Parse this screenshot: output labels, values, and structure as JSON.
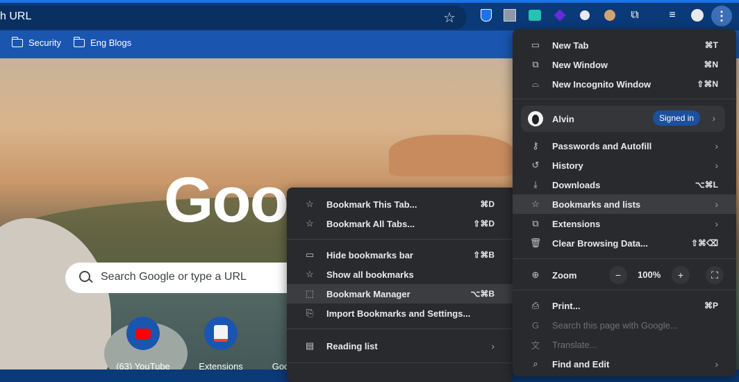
{
  "toolbar": {
    "omnibox_text": "h URL",
    "star_icon": "bookmark-star-icon",
    "extensions": [
      "shield-ext-icon",
      "square-ext-icon",
      "teal-ext-icon",
      "purple-ext-icon",
      "leaf-ext-icon",
      "owl-ext-icon",
      "puzzle-icon",
      "media-icon",
      "profile-avatar-icon"
    ],
    "menu_icon": "kebab-menu-icon"
  },
  "bookmarks_bar": {
    "items": [
      {
        "label": "Security"
      },
      {
        "label": "Eng Blogs"
      }
    ]
  },
  "new_tab": {
    "logo": "Goo",
    "search_placeholder": "Search Google or type a URL",
    "shortcuts": [
      {
        "label": "(63) YouTube"
      },
      {
        "label": "Extensions"
      },
      {
        "label": "Goo"
      }
    ]
  },
  "main_menu": {
    "items": [
      {
        "label": "New Tab",
        "shortcut": "⌘T",
        "icon": "new-tab-icon"
      },
      {
        "label": "New Window",
        "shortcut": "⌘N",
        "icon": "new-window-icon"
      },
      {
        "label": "New Incognito Window",
        "shortcut": "⇧⌘N",
        "icon": "incognito-icon"
      }
    ],
    "profile": {
      "name": "Alvin",
      "status": "Signed in"
    },
    "items2": [
      {
        "label": "Passwords and Autofill",
        "icon": "key-icon",
        "submenu": true
      },
      {
        "label": "History",
        "icon": "history-icon",
        "submenu": true
      },
      {
        "label": "Downloads",
        "icon": "download-icon",
        "shortcut": "⌥⌘L"
      },
      {
        "label": "Bookmarks and lists",
        "icon": "star-icon",
        "submenu": true,
        "highlighted": true
      },
      {
        "label": "Extensions",
        "icon": "puzzle-icon",
        "submenu": true
      },
      {
        "label": "Clear Browsing Data...",
        "icon": "trash-icon",
        "shortcut": "⇧⌘⌫"
      }
    ],
    "zoom": {
      "label": "Zoom",
      "minus": "−",
      "value": "100%",
      "plus": "+"
    },
    "items3": [
      {
        "label": "Print...",
        "icon": "print-icon",
        "shortcut": "⌘P"
      },
      {
        "label": "Search this page with Google...",
        "icon": "google-g-icon",
        "disabled": true
      },
      {
        "label": "Translate...",
        "icon": "translate-icon",
        "disabled": true
      },
      {
        "label": "Find and Edit",
        "icon": "find-icon",
        "submenu": true
      }
    ]
  },
  "bookmarks_submenu": {
    "items": [
      {
        "label": "Bookmark This Tab...",
        "shortcut": "⌘D",
        "icon": "star-outline-icon"
      },
      {
        "label": "Bookmark All Tabs...",
        "shortcut": "⇧⌘D",
        "icon": "star-outline-icon"
      }
    ],
    "items2": [
      {
        "label": "Hide bookmarks bar",
        "shortcut": "⇧⌘B",
        "icon": "bookmarks-bar-icon"
      },
      {
        "label": "Show all bookmarks",
        "icon": "star-outline-icon"
      },
      {
        "label": "Bookmark Manager",
        "shortcut": "⌥⌘B",
        "icon": "bookmark-manager-icon",
        "highlighted": true
      },
      {
        "label": "Import Bookmarks and Settings...",
        "icon": "import-icon"
      }
    ],
    "items3": [
      {
        "label": "Reading list",
        "icon": "reading-list-icon",
        "submenu": true
      }
    ]
  }
}
